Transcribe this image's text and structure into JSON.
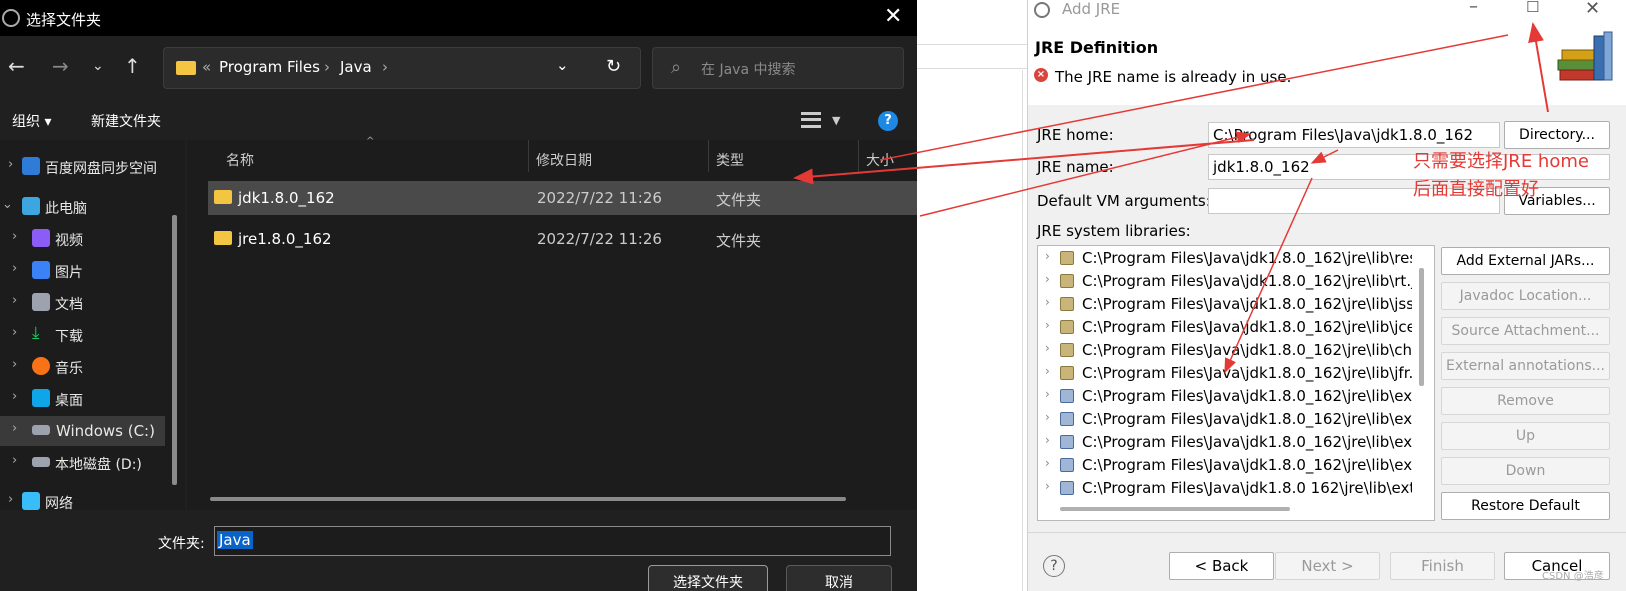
{
  "picker": {
    "title": "选择文件夹",
    "breadcrumb": {
      "sep_prefix": "«",
      "crumbs": [
        "Program Files",
        "Java"
      ]
    },
    "search_placeholder": "在 Java 中搜索",
    "toolbar": {
      "organize": "组织 ▾",
      "new_folder": "新建文件夹"
    },
    "sidebar": [
      {
        "label": "百度网盘同步空间",
        "icon": "baidu-cloud-icon"
      },
      {
        "label": "此电脑",
        "icon": "this-pc-icon"
      },
      {
        "label": "视频",
        "icon": "video-folder-icon"
      },
      {
        "label": "图片",
        "icon": "pictures-folder-icon"
      },
      {
        "label": "文档",
        "icon": "documents-folder-icon"
      },
      {
        "label": "下载",
        "icon": "download-icon"
      },
      {
        "label": "音乐",
        "icon": "music-icon"
      },
      {
        "label": "桌面",
        "icon": "desktop-icon"
      },
      {
        "label": "Windows (C:)",
        "icon": "drive-icon"
      },
      {
        "label": "本地磁盘 (D:)",
        "icon": "drive-icon"
      },
      {
        "label": "网络",
        "icon": "network-icon"
      }
    ],
    "columns": [
      "名称",
      "修改日期",
      "类型",
      "大小"
    ],
    "files": [
      {
        "name": "jdk1.8.0_162",
        "date": "2022/7/22 11:26",
        "type": "文件夹"
      },
      {
        "name": "jre1.8.0_162",
        "date": "2022/7/22 11:26",
        "type": "文件夹"
      }
    ],
    "folder_label": "文件夹:",
    "folder_value": "Java",
    "select_button": "选择文件夹",
    "cancel_button": "取消"
  },
  "jre": {
    "window_title": "Add JRE",
    "heading": "JRE Definition",
    "error": "The JRE name is already in use.",
    "home_label": "JRE home:",
    "home_value": "C:\\Program Files\\Java\\jdk1.8.0_162",
    "name_label": "JRE name:",
    "name_value": "jdk1.8.0_162",
    "vm_label": "Default VM arguments:",
    "vm_value": "",
    "libs_label": "JRE system libraries:",
    "directory_button": "Directory...",
    "variables_button": "Variables...",
    "libraries": [
      "C:\\Program Files\\Java\\jdk1.8.0_162\\jre\\lib\\res",
      "C:\\Program Files\\Java\\jdk1.8.0_162\\jre\\lib\\rt.ja",
      "C:\\Program Files\\Java\\jdk1.8.0_162\\jre\\lib\\jsse",
      "C:\\Program Files\\Java\\jdk1.8.0_162\\jre\\lib\\jce",
      "C:\\Program Files\\Java\\jdk1.8.0_162\\jre\\lib\\cha",
      "C:\\Program Files\\Java\\jdk1.8.0_162\\jre\\lib\\jfr.j",
      "C:\\Program Files\\Java\\jdk1.8.0_162\\jre\\lib\\ext",
      "C:\\Program Files\\Java\\jdk1.8.0_162\\jre\\lib\\ext",
      "C:\\Program Files\\Java\\jdk1.8.0_162\\jre\\lib\\ext",
      "C:\\Program Files\\Java\\jdk1.8.0_162\\jre\\lib\\ext",
      "C:\\Program Files\\Java\\jdk1.8.0 162\\jre\\lib\\ext"
    ],
    "side_buttons": [
      {
        "label": "Add External JARs...",
        "enabled": true
      },
      {
        "label": "Javadoc Location...",
        "enabled": false
      },
      {
        "label": "Source Attachment...",
        "enabled": false
      },
      {
        "label": "External annotations...",
        "enabled": false
      },
      {
        "label": "Remove",
        "enabled": false
      },
      {
        "label": "Up",
        "enabled": false
      },
      {
        "label": "Down",
        "enabled": false
      },
      {
        "label": "Restore Default",
        "enabled": true
      }
    ],
    "footer": {
      "back": "< Back",
      "next": "Next >",
      "finish": "Finish",
      "cancel": "Cancel"
    },
    "annotation_line1": "只需要选择JRE home",
    "annotation_line2": "后面直接配置好",
    "watermark": "CSDN @浩彦"
  },
  "colors": {
    "annotation": "#e53935",
    "selection": "#0a64c8",
    "dark_bg": "#202020"
  }
}
